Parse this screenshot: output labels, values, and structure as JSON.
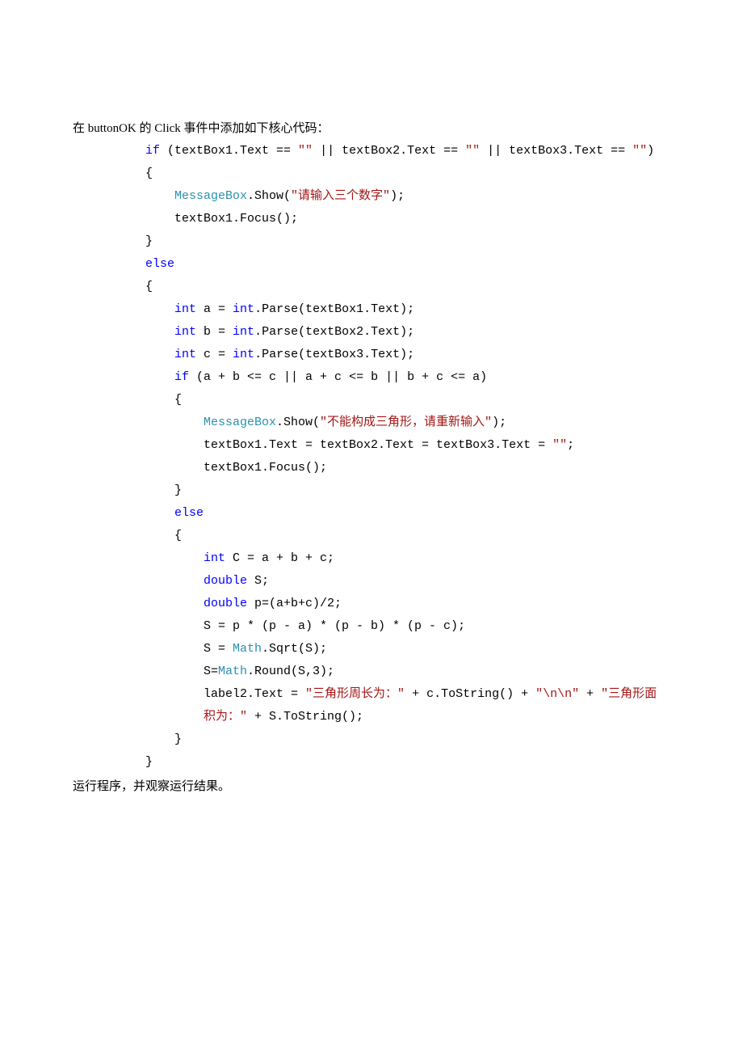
{
  "intro_prefix": "在 ",
  "intro_en1": "buttonOK ",
  "intro_mid1": "的 ",
  "intro_en2": "Click ",
  "intro_suffix": "事件中添加如下核心代码：",
  "code": {
    "l01a": "if",
    "l01b": " (textBox1.Text == ",
    "l01c": "\"\"",
    "l01d": " || textBox2.Text == ",
    "l01e": "\"\"",
    "l01f": " || textBox3.Text == ",
    "l01g": "\"\"",
    "l01h": ")",
    "l02": "{",
    "l03a": "    ",
    "l03b": "MessageBox",
    "l03c": ".Show(",
    "l03d": "\"请输入三个数字\"",
    "l03e": ");",
    "l04": "    textBox1.Focus();",
    "l05": "}",
    "l06": "else",
    "l07": "{",
    "l08a": "    ",
    "l08b": "int",
    "l08c": " a = ",
    "l08d": "int",
    "l08e": ".Parse(textBox1.Text);",
    "l09a": "    ",
    "l09b": "int",
    "l09c": " b = ",
    "l09d": "int",
    "l09e": ".Parse(textBox2.Text);",
    "l10a": "    ",
    "l10b": "int",
    "l10c": " c = ",
    "l10d": "int",
    "l10e": ".Parse(textBox3.Text);",
    "l11a": "    ",
    "l11b": "if",
    "l11c": " (a + b <= c || a + c <= b || b + c <= a)",
    "l12": "    {",
    "l13a": "        ",
    "l13b": "MessageBox",
    "l13c": ".Show(",
    "l13d": "\"不能构成三角形，请重新输入\"",
    "l13e": ");",
    "l14a": "        textBox1.Text = textBox2.Text = textBox3.Text = ",
    "l14b": "\"\"",
    "l14c": ";",
    "l15": "        textBox1.Focus();",
    "l16": "    }",
    "l17a": "    ",
    "l17b": "else",
    "l18": "    {",
    "l19a": "        ",
    "l19b": "int",
    "l19c": " C = a + b + c;",
    "l20a": "        ",
    "l20b": "double",
    "l20c": " S;",
    "l21a": "        ",
    "l21b": "double",
    "l21c": " p=(a+b+c)/2;",
    "l22": "        S = p * (p - a) * (p - b) * (p - c);",
    "l23a": "        S = ",
    "l23b": "Math",
    "l23c": ".Sqrt(S);",
    "l24a": "        S=",
    "l24b": "Math",
    "l24c": ".Round(S,3);",
    "l25a": "        label2.Text = ",
    "l25b": "\"三角形周长为：\"",
    "l25c": " + c.ToString() + ",
    "l25d": "\"\\n\\n\"",
    "l25e": " + ",
    "l25f": "\"三角形面",
    "l26a": "        ",
    "l26b": "积为：\"",
    "l26c": " + S.ToString();",
    "l27": "    }",
    "l28": "}"
  },
  "footer": "运行程序，并观察运行结果。"
}
